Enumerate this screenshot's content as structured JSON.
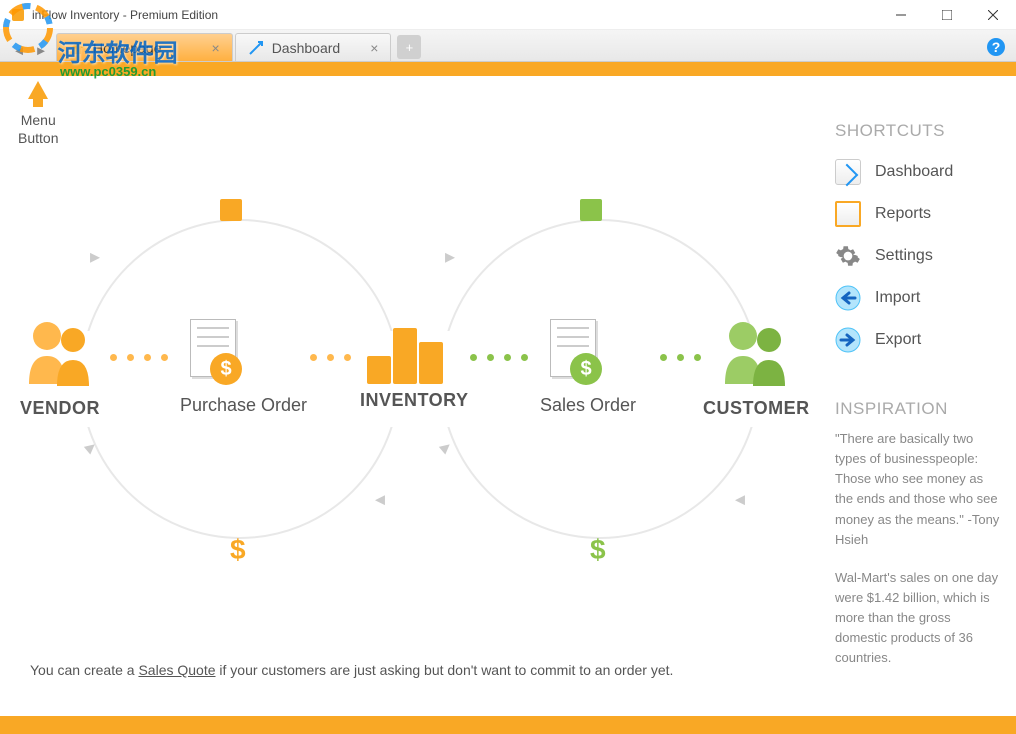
{
  "window": {
    "title": "inFlow Inventory - Premium Edition"
  },
  "watermark": {
    "text": "河东软件园",
    "url": "www.pc0359.cn"
  },
  "tabs": [
    {
      "label": "Homepage",
      "active": true
    },
    {
      "label": "Dashboard",
      "active": false
    }
  ],
  "menu_button": {
    "line1": "Menu",
    "line2": "Button"
  },
  "flow": {
    "vendor": "VENDOR",
    "purchase_order": "Purchase Order",
    "inventory": "INVENTORY",
    "sales_order": "Sales Order",
    "customer": "CUSTOMER"
  },
  "tip": {
    "prefix": "You can create a ",
    "link": "Sales Quote",
    "suffix": " if your customers are just asking but don't want to commit to an order yet."
  },
  "shortcuts": {
    "heading": "SHORTCUTS",
    "items": [
      {
        "label": "Dashboard"
      },
      {
        "label": "Reports"
      },
      {
        "label": "Settings"
      },
      {
        "label": "Import"
      },
      {
        "label": "Export"
      }
    ]
  },
  "inspiration": {
    "heading": "INSPIRATION",
    "quote1": "\"There are basically two types of businesspeople: Those who see money as the ends and those who see money as the means.\" -Tony Hsieh",
    "quote2": "Wal-Mart's sales on one day were $1.42 billion, which is more than the gross domestic products of 36 countries."
  }
}
